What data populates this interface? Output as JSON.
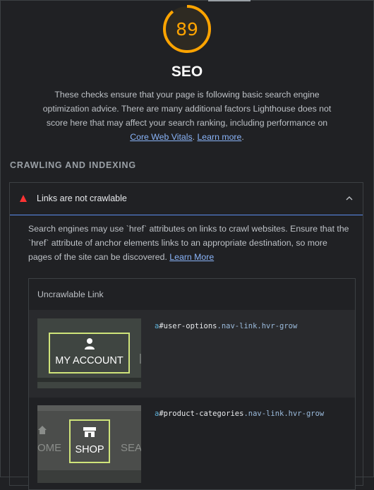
{
  "score": {
    "value": "89",
    "fraction": 0.89,
    "color": "#ffa400"
  },
  "category": {
    "title": "SEO",
    "desc_text": "These checks ensure that your page is following basic search engine optimization advice. There are many additional factors Lighthouse does not score here that may affect your search ranking, including performance on ",
    "link_cwv": "Core Web Vitals",
    "desc_sep": ". ",
    "link_learn": "Learn more",
    "desc_end": "."
  },
  "section": {
    "title": "CRAWLING AND INDEXING"
  },
  "audit": {
    "status_color": "#f33",
    "title": "Links are not crawlable",
    "desc_text": "Search engines may use `href` attributes on links to crawl websites. Ensure that the `href` attribute of anchor elements links to an appropriate destination, so more pages of the site can be discovered. ",
    "desc_link": "Learn More",
    "table": {
      "header": "Uncrawlable Link",
      "rows": [
        {
          "tag": "a",
          "id": "#user-options",
          "classes": ".nav-link.hvr-grow",
          "thumb_label": "MY ACCOUNT",
          "thumb_icon": "user-icon"
        },
        {
          "tag": "a",
          "id": "#product-categories",
          "classes": ".nav-link.hvr-grow",
          "thumb_label": "SHOP",
          "thumb_icon": "store-icon",
          "thumb_left_fragment": "OME",
          "thumb_right_fragment": "SEA"
        }
      ]
    }
  }
}
